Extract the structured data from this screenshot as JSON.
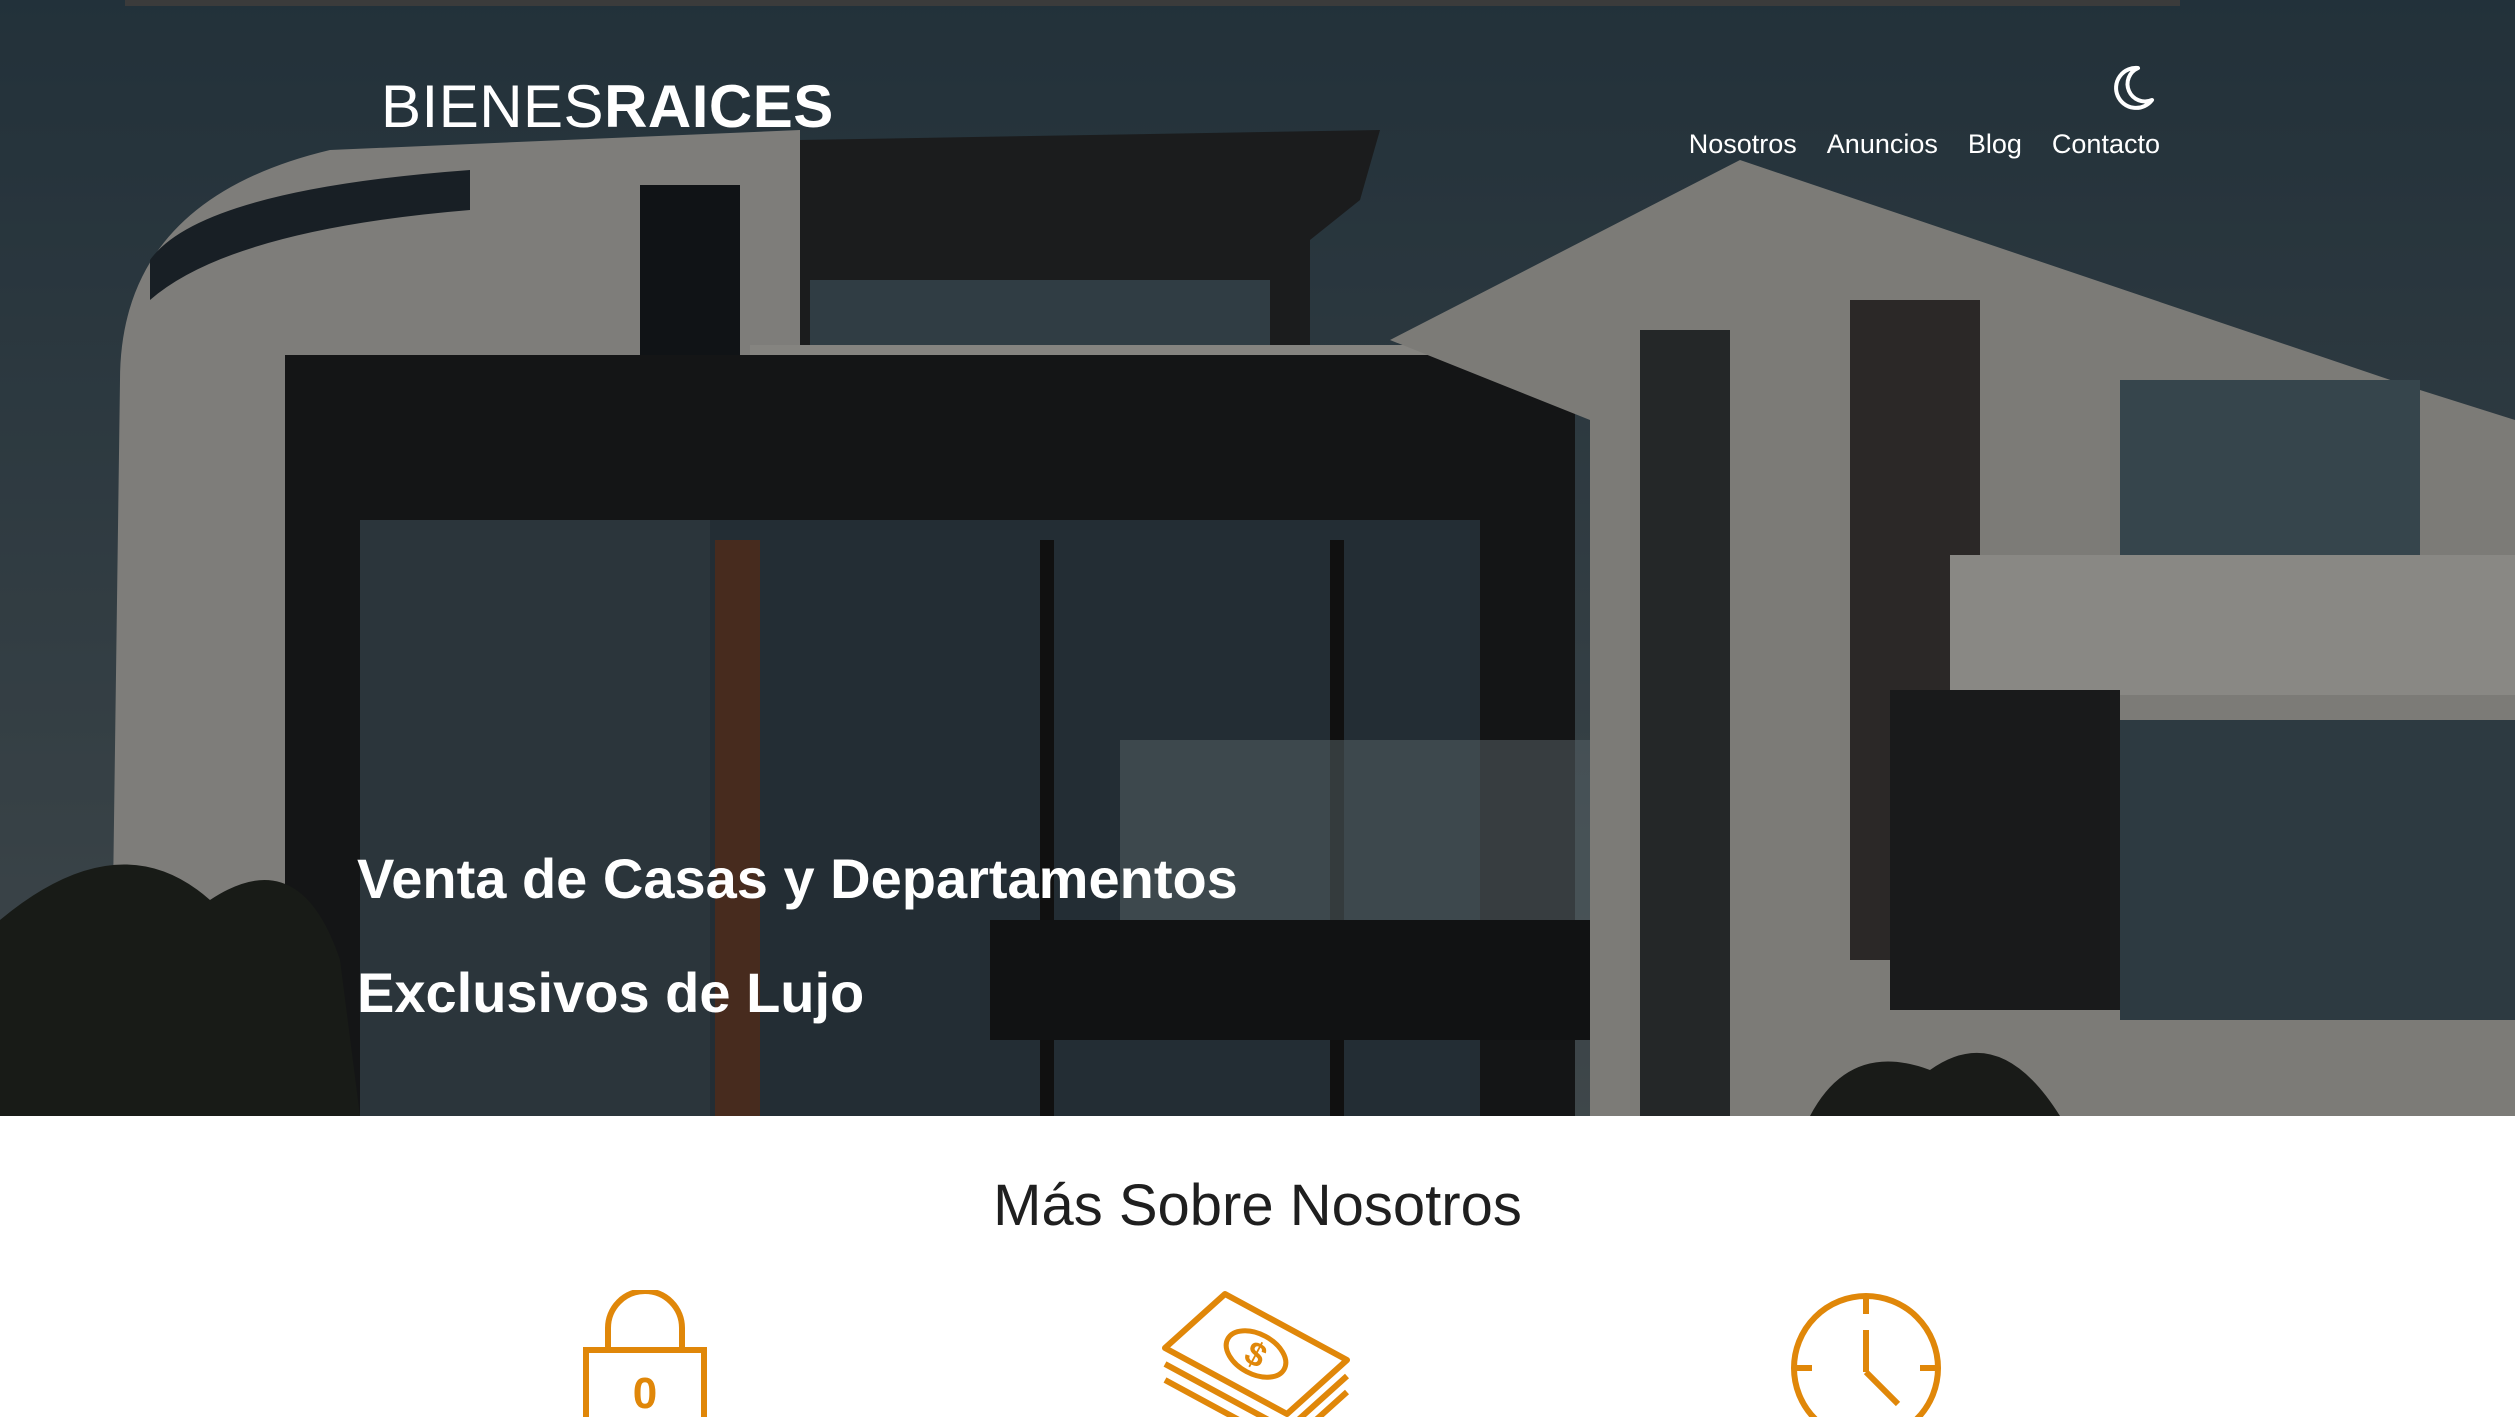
{
  "header": {
    "logo_thin": "BIENES",
    "logo_bold": "RAICES",
    "theme_icon": "moon-icon",
    "nav": [
      "Nosotros",
      "Anuncios",
      "Blog",
      "Contacto"
    ]
  },
  "hero": {
    "title_line1": "Venta de Casas y Departamentos",
    "title_line2": "Exclusivos de Lujo"
  },
  "about": {
    "title": "Más Sobre Nosotros",
    "icons": [
      "lock-icon",
      "money-icon",
      "clock-icon"
    ],
    "lock_digit": "0"
  },
  "colors": {
    "accent": "#E08709",
    "text_light": "#FFFFFF",
    "text_dark": "#1F1F1F"
  }
}
